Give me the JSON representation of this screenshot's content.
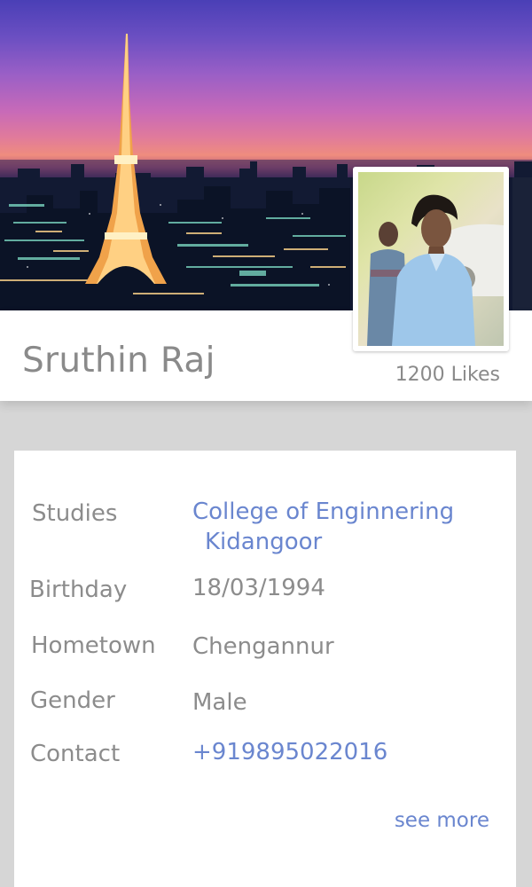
{
  "profile": {
    "name": "Sruthin Raj",
    "likes": "1200 Likes"
  },
  "details": {
    "studies_label": "Studies",
    "studies_line1": "College of Enginnering",
    "studies_line2": "Kidangoor",
    "birthday_label": "Birthday",
    "birthday_value": "18/03/1994",
    "hometown_label": "Hometown",
    "hometown_value": "Chengannur",
    "gender_label": "Gender",
    "gender_value": "Male",
    "contact_label": "Contact",
    "contact_value": "+919895022016"
  },
  "see_more": "see more",
  "colors": {
    "link": "#6a86cf",
    "muted_text": "#8c8c8c",
    "background": "#d6d6d6"
  }
}
